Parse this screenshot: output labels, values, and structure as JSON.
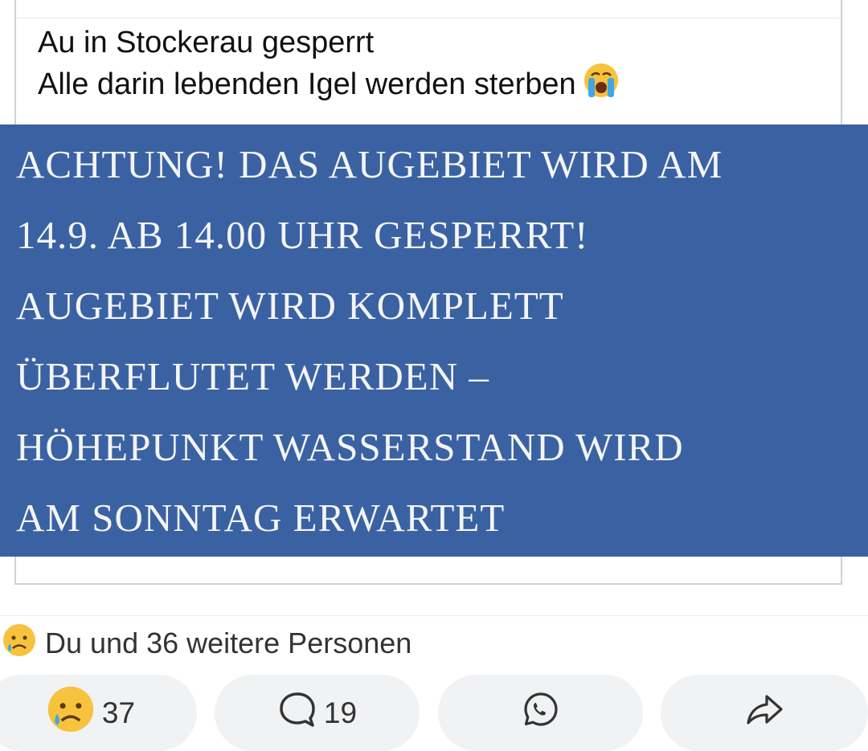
{
  "post": {
    "caption_line1": "Au in Stockerau gesperrt",
    "caption_line2": "Alle darin lebenden Igel werden sterben",
    "caption_emoji_icon": "loudly-crying-face-icon"
  },
  "notice_image": {
    "background_color": "#3a62a3",
    "lines": [
      "ACHTUNG! DAS AUGEBIET WIRD AM",
      "14.9. AB 14.00 UHR GESPERRT!",
      "AUGEBIET WIRD KOMPLETT",
      "ÜBERFLUTET WERDEN –",
      "HÖHEPUNKT WASSERSTAND WIRD",
      "AM SONNTAG ERWARTET"
    ]
  },
  "reactions": {
    "icon": "sad-tear-face-icon",
    "summary": "Du und 36 weitere Personen"
  },
  "actions": {
    "reaction_count": "37",
    "comment_count": "19",
    "reaction_icon": "sad-tear-face-icon",
    "comment_icon": "comment-bubble-icon",
    "whatsapp_icon": "whatsapp-icon",
    "share_icon": "share-arrow-icon"
  }
}
